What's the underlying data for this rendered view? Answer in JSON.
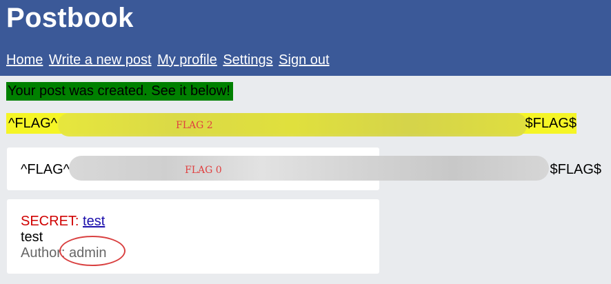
{
  "app": {
    "title": "Postbook"
  },
  "nav": [
    {
      "label": "Home"
    },
    {
      "label": "Write a new post"
    },
    {
      "label": "My profile"
    },
    {
      "label": "Settings"
    },
    {
      "label": "Sign out"
    }
  ],
  "alert": {
    "text": "Your post was created. See it below!"
  },
  "flag2": {
    "start": "^FLAG^",
    "end": "$FLAG$",
    "annotation": "FLAG 2"
  },
  "flag0": {
    "start": "^FLAG^",
    "end": "$FLAG$",
    "annotation": "FLAG 0"
  },
  "post": {
    "secret_label": "SECRET:",
    "title": "test",
    "body": "test",
    "author_label": "Author:",
    "author": "admin"
  },
  "colors": {
    "header": "#3b5998",
    "alert": "#008000",
    "flag_highlight": "#f5f526",
    "secret": "#d00000",
    "annotation": "#d94040"
  }
}
